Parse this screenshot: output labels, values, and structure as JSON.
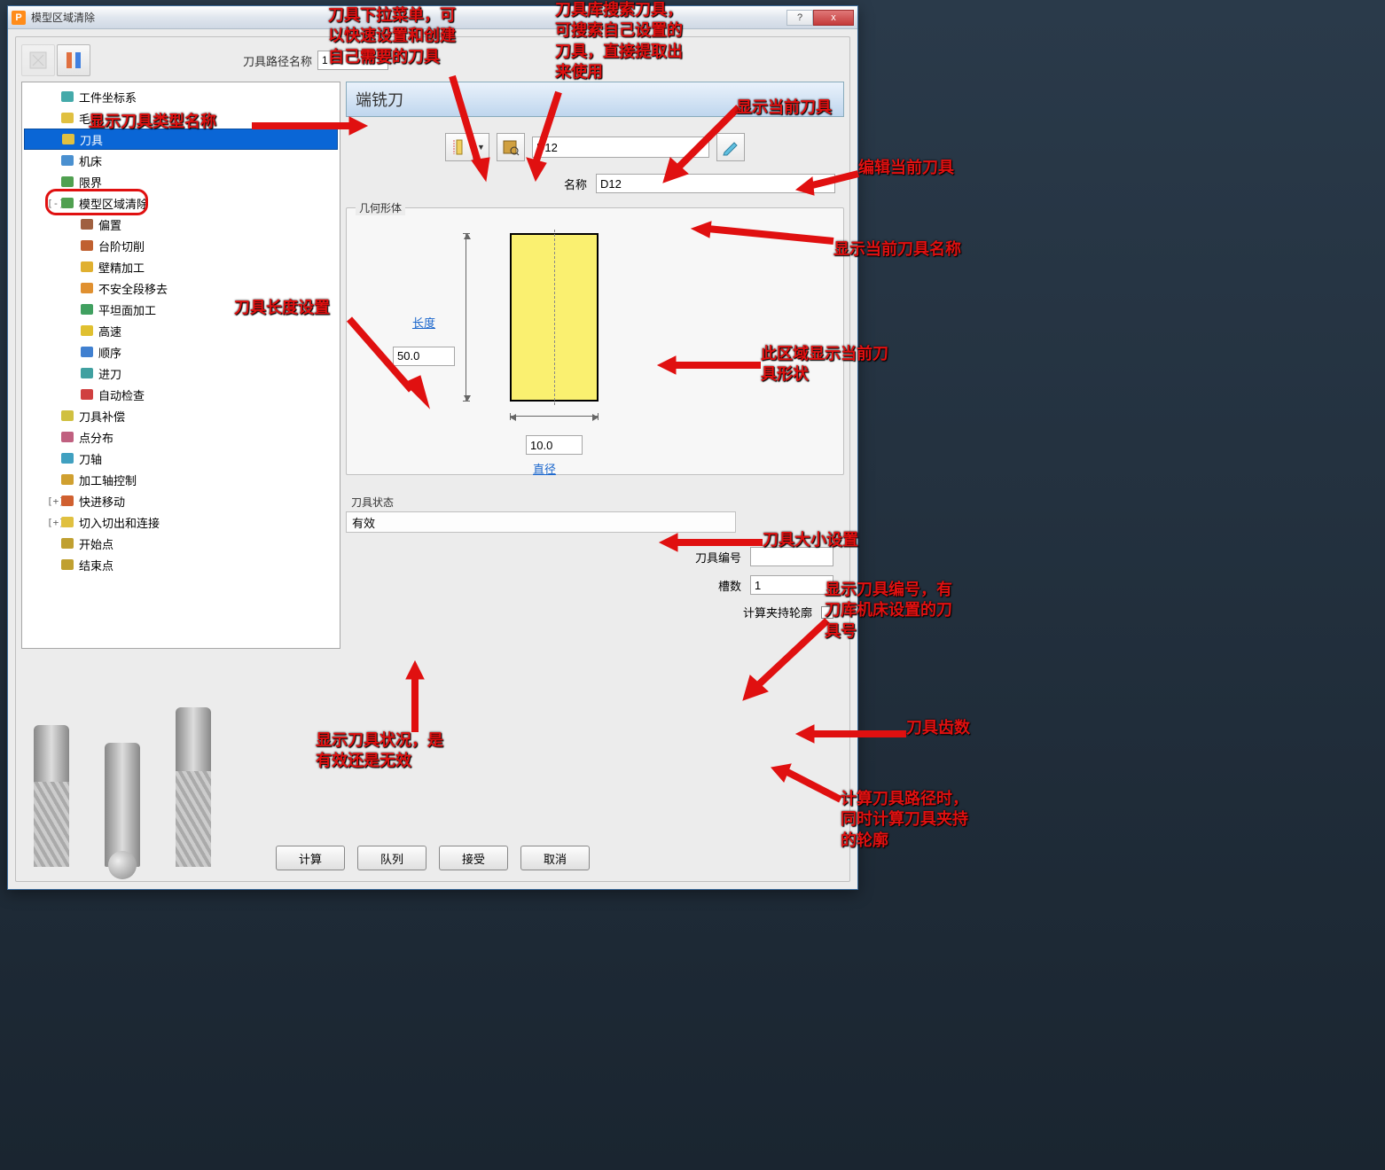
{
  "window": {
    "title": "模型区域清除",
    "help": "?",
    "close": "x"
  },
  "toolbar": {
    "toolpath_name_label": "刀具路径名称",
    "toolpath_name_value": "1"
  },
  "tree": {
    "items": [
      {
        "lvl": 2,
        "label": "工件坐标系",
        "icon": "axis"
      },
      {
        "lvl": 2,
        "label": "毛坯",
        "icon": "block"
      },
      {
        "lvl": 2,
        "label": "刀具",
        "icon": "tool",
        "selected": true
      },
      {
        "lvl": 2,
        "label": "机床",
        "icon": "machine"
      },
      {
        "lvl": 2,
        "label": "限界",
        "icon": "boundary"
      },
      {
        "lvl": 2,
        "label": "模型区域清除",
        "icon": "strategy",
        "exp": "-"
      },
      {
        "lvl": 3,
        "label": "偏置",
        "icon": "offset"
      },
      {
        "lvl": 3,
        "label": "台阶切削",
        "icon": "step"
      },
      {
        "lvl": 3,
        "label": "壁精加工",
        "icon": "wall"
      },
      {
        "lvl": 3,
        "label": "不安全段移去",
        "icon": "unsafe"
      },
      {
        "lvl": 3,
        "label": "平坦面加工",
        "icon": "flat"
      },
      {
        "lvl": 3,
        "label": "高速",
        "icon": "speed"
      },
      {
        "lvl": 3,
        "label": "顺序",
        "icon": "order"
      },
      {
        "lvl": 3,
        "label": "进刀",
        "icon": "approach"
      },
      {
        "lvl": 3,
        "label": "自动检查",
        "icon": "check"
      },
      {
        "lvl": 2,
        "label": "刀具补偿",
        "icon": "comp"
      },
      {
        "lvl": 2,
        "label": "点分布",
        "icon": "points"
      },
      {
        "lvl": 2,
        "label": "刀轴",
        "icon": "axis2"
      },
      {
        "lvl": 2,
        "label": "加工轴控制",
        "icon": "machaxis"
      },
      {
        "lvl": 2,
        "label": "快进移动",
        "icon": "rapid",
        "exp": "+"
      },
      {
        "lvl": 2,
        "label": "切入切出和连接",
        "icon": "leads",
        "exp": "+"
      },
      {
        "lvl": 2,
        "label": "开始点",
        "icon": "start"
      },
      {
        "lvl": 2,
        "label": "结束点",
        "icon": "end"
      }
    ]
  },
  "panel": {
    "tool_type": "端铣刀",
    "tool_select": "D12",
    "name_label": "名称",
    "name_value": "D12",
    "geometry_legend": "几何形体",
    "length_label": "长度",
    "length_value": "50.0",
    "diameter_value": "10.0",
    "diameter_label": "直径",
    "state_legend": "刀具状态",
    "state_value": "有效",
    "toolno_label": "刀具编号",
    "toolno_value": "",
    "flutes_label": "槽数",
    "flutes_value": "1",
    "calc_holder_label": "计算夹持轮廓"
  },
  "buttons": {
    "calculate": "计算",
    "queue": "队列",
    "accept": "接受",
    "cancel": "取消"
  },
  "annotations": {
    "a1": "显示刀具类型名称",
    "a2": "刀具下拉菜单，可\n以快速设置和创建\n自己需要的刀具",
    "a3": "刀具库搜索刀具，\n可搜索自己设置的\n刀具，直接提取出\n来使用",
    "a4": "显示当前刀具",
    "a5": "编辑当前刀具",
    "a6": "显示当前刀具名称",
    "a7": "刀具长度设置",
    "a8": "此区域显示当前刀\n具形状",
    "a9": "刀具大小设置",
    "a10": "显示刀具编号，有\n刀库机床设置的刀\n具号",
    "a11": "刀具齿数",
    "a12": "显示刀具状况，是\n有效还是无效",
    "a13": "计算刀具路径时，\n同时计算刀具夹持\n的轮廓"
  }
}
